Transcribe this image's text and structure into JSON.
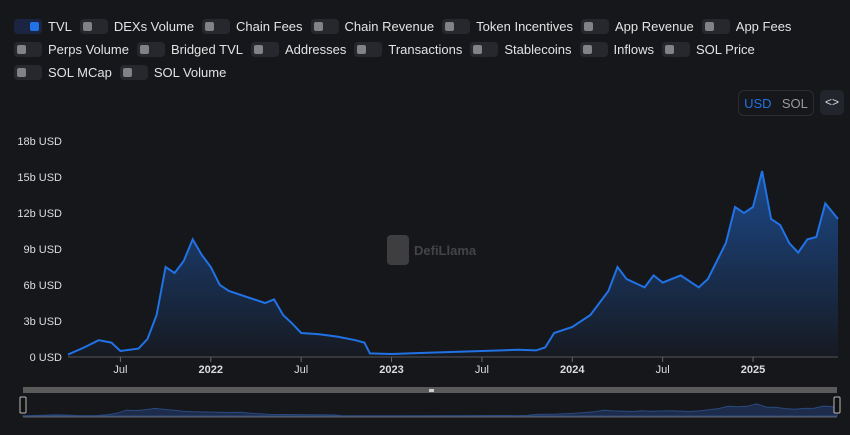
{
  "toggles": [
    {
      "label": "TVL",
      "on": true
    },
    {
      "label": "DEXs Volume",
      "on": false
    },
    {
      "label": "Chain Fees",
      "on": false
    },
    {
      "label": "Chain Revenue",
      "on": false
    },
    {
      "label": "Token Incentives",
      "on": false
    },
    {
      "label": "App Revenue",
      "on": false
    },
    {
      "label": "App Fees",
      "on": false
    },
    {
      "label": "Perps Volume",
      "on": false
    },
    {
      "label": "Bridged TVL",
      "on": false
    },
    {
      "label": "Addresses",
      "on": false
    },
    {
      "label": "Transactions",
      "on": false
    },
    {
      "label": "Stablecoins",
      "on": false
    },
    {
      "label": "Inflows",
      "on": false
    },
    {
      "label": "SOL Price",
      "on": false
    },
    {
      "label": "SOL MCap",
      "on": false
    },
    {
      "label": "SOL Volume",
      "on": false
    }
  ],
  "unit": {
    "usd": "USD",
    "sol": "SOL",
    "embed": "<>"
  },
  "watermark": "DefiLlama",
  "chart_data": {
    "type": "area",
    "title": "",
    "xlabel": "",
    "ylabel": "",
    "series": [
      {
        "name": "TVL",
        "color": "#2172e5",
        "unit": "b USD"
      }
    ],
    "ylim": [
      0,
      18
    ],
    "yticks": [
      "0 USD",
      "3b USD",
      "6b USD",
      "9b USD",
      "12b USD",
      "15b USD",
      "18b USD"
    ],
    "xticks": [
      {
        "label": "Jul",
        "x": 2021.5
      },
      {
        "label": "2022",
        "x": 2022.0
      },
      {
        "label": "Jul",
        "x": 2022.5
      },
      {
        "label": "2023",
        "x": 2023.0
      },
      {
        "label": "Jul",
        "x": 2023.5
      },
      {
        "label": "2024",
        "x": 2024.0
      },
      {
        "label": "Jul",
        "x": 2024.5
      },
      {
        "label": "2025",
        "x": 2025.0
      }
    ],
    "xlim": [
      2021.21,
      2025.47
    ],
    "points": [
      [
        2021.21,
        0.2
      ],
      [
        2021.3,
        0.8
      ],
      [
        2021.38,
        1.4
      ],
      [
        2021.45,
        1.2
      ],
      [
        2021.5,
        0.5
      ],
      [
        2021.6,
        0.7
      ],
      [
        2021.65,
        1.5
      ],
      [
        2021.7,
        3.5
      ],
      [
        2021.75,
        7.5
      ],
      [
        2021.8,
        7.0
      ],
      [
        2021.85,
        8.0
      ],
      [
        2021.9,
        9.8
      ],
      [
        2021.95,
        8.5
      ],
      [
        2022.0,
        7.5
      ],
      [
        2022.05,
        6.0
      ],
      [
        2022.1,
        5.5
      ],
      [
        2022.2,
        5.0
      ],
      [
        2022.3,
        4.5
      ],
      [
        2022.35,
        4.8
      ],
      [
        2022.4,
        3.5
      ],
      [
        2022.45,
        2.8
      ],
      [
        2022.5,
        2.0
      ],
      [
        2022.6,
        1.9
      ],
      [
        2022.7,
        1.7
      ],
      [
        2022.8,
        1.4
      ],
      [
        2022.85,
        1.2
      ],
      [
        2022.88,
        0.3
      ],
      [
        2023.0,
        0.25
      ],
      [
        2023.2,
        0.35
      ],
      [
        2023.5,
        0.5
      ],
      [
        2023.7,
        0.6
      ],
      [
        2023.8,
        0.55
      ],
      [
        2023.85,
        0.8
      ],
      [
        2023.9,
        2.0
      ],
      [
        2024.0,
        2.5
      ],
      [
        2024.1,
        3.5
      ],
      [
        2024.2,
        5.5
      ],
      [
        2024.25,
        7.5
      ],
      [
        2024.3,
        6.5
      ],
      [
        2024.4,
        5.8
      ],
      [
        2024.45,
        6.8
      ],
      [
        2024.5,
        6.2
      ],
      [
        2024.6,
        6.8
      ],
      [
        2024.7,
        5.8
      ],
      [
        2024.75,
        6.5
      ],
      [
        2024.8,
        8.0
      ],
      [
        2024.85,
        9.5
      ],
      [
        2024.9,
        12.5
      ],
      [
        2024.95,
        12.0
      ],
      [
        2025.0,
        12.5
      ],
      [
        2025.05,
        15.5
      ],
      [
        2025.1,
        11.5
      ],
      [
        2025.15,
        11.0
      ],
      [
        2025.2,
        9.5
      ],
      [
        2025.25,
        8.7
      ],
      [
        2025.3,
        9.8
      ],
      [
        2025.35,
        10.0
      ],
      [
        2025.4,
        12.8
      ],
      [
        2025.47,
        11.5
      ]
    ]
  }
}
